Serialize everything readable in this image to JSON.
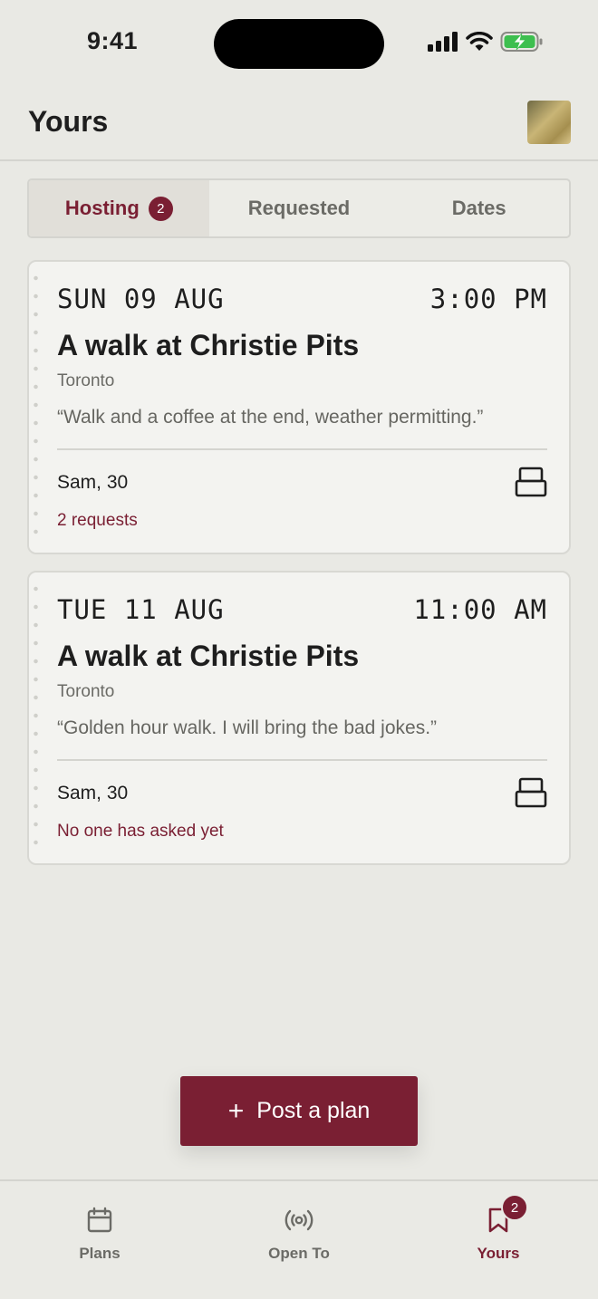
{
  "status_bar": {
    "time": "9:41"
  },
  "header": {
    "title": "Yours"
  },
  "segmented": {
    "tabs": [
      {
        "label": "Hosting",
        "badge": "2",
        "active": true
      },
      {
        "label": "Requested"
      },
      {
        "label": "Dates"
      }
    ]
  },
  "cards": [
    {
      "date": "SUN 09 AUG",
      "time": "3:00 PM",
      "title": "A walk at Christie Pits",
      "city": "Toronto",
      "quote": "“Walk and a coffee at the end, weather permitting.”",
      "host": "Sam, 30",
      "status": "2 requests"
    },
    {
      "date": "TUE 11 AUG",
      "time": "11:00 AM",
      "title": "A walk at Christie Pits",
      "city": "Toronto",
      "quote": "“Golden hour walk. I will bring the bad jokes.”",
      "host": "Sam, 30",
      "status": "No one has asked yet"
    }
  ],
  "fab": {
    "icon": "plus-icon",
    "label": "Post a plan"
  },
  "tabbar": {
    "items": [
      {
        "label": "Plans",
        "icon": "calendar-icon"
      },
      {
        "label": "Open To",
        "icon": "broadcast-icon"
      },
      {
        "label": "Yours",
        "icon": "bookmark-icon",
        "badge": "2",
        "active": true
      }
    ]
  },
  "colors": {
    "accent": "#7a1f33",
    "background": "#e9e9e4",
    "card": "#f3f3f0"
  }
}
